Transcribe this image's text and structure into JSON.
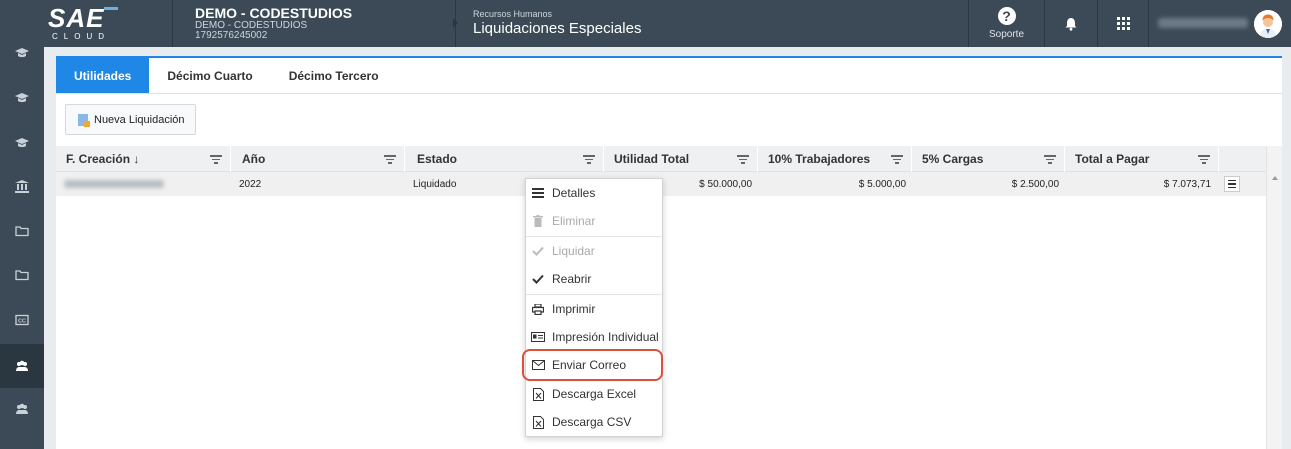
{
  "header": {
    "logo_main": "SAE",
    "logo_sub": "CLOUD",
    "company_name": "DEMO - CODESTUDIOS",
    "company_sub": "DEMO - CODESTUDIOS",
    "company_ruc": "1792576245002",
    "section_small": "Recursos Humanos",
    "section_title": "Liquidaciones Especiales",
    "help_label": "Soporte",
    "help_glyph": "?"
  },
  "sidebar": {
    "items": [
      {
        "icon": "graduation-icon",
        "active": false
      },
      {
        "icon": "graduation-icon",
        "active": false
      },
      {
        "icon": "graduation-icon",
        "active": false
      },
      {
        "icon": "bank-icon",
        "active": false
      },
      {
        "icon": "folder-icon",
        "active": false
      },
      {
        "icon": "folder-icon",
        "active": false
      },
      {
        "icon": "cc-icon",
        "active": false
      },
      {
        "icon": "users-icon",
        "active": true
      },
      {
        "icon": "users-icon",
        "active": false
      }
    ]
  },
  "tabs": [
    {
      "label": "Utilidades",
      "active": true
    },
    {
      "label": "Décimo Cuarto",
      "active": false
    },
    {
      "label": "Décimo Tercero",
      "active": false
    }
  ],
  "toolbar": {
    "new_label": "Nueva Liquidación"
  },
  "table": {
    "columns": [
      "F. Creación ↓",
      "Año",
      "Estado",
      "Utilidad Total",
      "10% Trabajadores",
      "5% Cargas",
      "Total a Pagar"
    ],
    "row": {
      "anio": "2022",
      "estado": "Liquidado",
      "utilidad_total": "$ 50.000,00",
      "trabajadores": "$ 5.000,00",
      "cargas": "$ 2.500,00",
      "total_pagar": "$ 7.073,71"
    }
  },
  "menu": {
    "items": [
      {
        "label": "Detalles",
        "icon": "list-icon",
        "disabled": false
      },
      {
        "label": "Eliminar",
        "icon": "trash-icon",
        "disabled": true
      },
      {
        "label": "Liquidar",
        "icon": "check-icon",
        "disabled": true
      },
      {
        "label": "Reabrir",
        "icon": "check-icon",
        "disabled": false
      },
      {
        "label": "Imprimir",
        "icon": "printer-icon",
        "disabled": false
      },
      {
        "label": "Impresión Individual",
        "icon": "id-card-icon",
        "disabled": false
      },
      {
        "label": "Enviar Correo",
        "icon": "envelope-icon",
        "disabled": false
      },
      {
        "label": "Descarga Excel",
        "icon": "excel-file-icon",
        "disabled": false
      },
      {
        "label": "Descarga CSV",
        "icon": "csv-file-icon",
        "disabled": false
      }
    ]
  },
  "colors": {
    "accent": "#1f87e5",
    "topbar": "#3b4a56",
    "highlight": "#d9503c"
  }
}
